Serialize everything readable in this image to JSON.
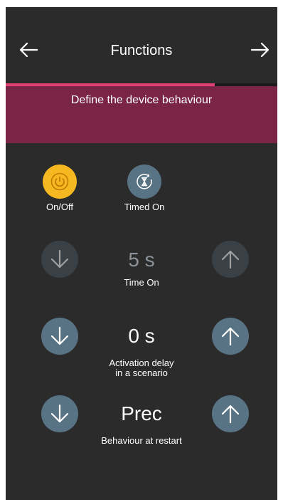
{
  "header": {
    "title": "Functions",
    "back_icon": "arrow-left-icon",
    "next_icon": "arrow-right-icon",
    "progress": 0.77,
    "progress_color": "#e23f73"
  },
  "banner": {
    "text": "Define the device behaviour",
    "color": "#7a2446"
  },
  "modes": [
    {
      "label": "On/Off",
      "icon": "power-icon",
      "selected": true,
      "color": "#f5b821"
    },
    {
      "label": "Timed On",
      "icon": "hourglass-icon",
      "selected": false,
      "color": "#587384"
    }
  ],
  "settings": [
    {
      "value": "5 s",
      "label": "Time On",
      "enabled": false
    },
    {
      "value": "0 s",
      "label_line1": "Activation delay",
      "label_line2": "in a scenario",
      "enabled": true
    },
    {
      "value": "Prec",
      "label": "Behaviour at restart",
      "enabled": true
    }
  ]
}
